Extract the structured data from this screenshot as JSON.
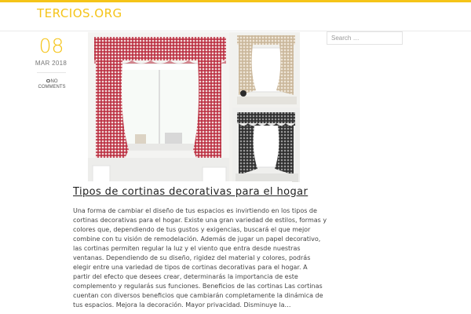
{
  "site": {
    "title": "TERCIOS.ORG",
    "accent_color": "#f5c418"
  },
  "search": {
    "placeholder": "Search …"
  },
  "post": {
    "day": "08",
    "month_year": "MAR 2018",
    "comments_line1": "NO",
    "comments_line2": "COMMENTS",
    "comments_icon": "comment-bubble-icon",
    "title": "Tipos de cortinas decorativas para el hogar",
    "excerpt_lines": [
      "Una forma de cambiar el diseño de tus espacios es invirtiendo en los tipos de",
      "cortinas decorativas para el hogar. Existe una gran variedad de estilos, formas y",
      "colores que, dependiendo de tus gustos y exigencias, buscará el que mejor",
      "combine con tu visión de remodelación. Además de jugar un papel decorativo,",
      "las cortinas permiten regular la luz y el viento que entra desde nuestras",
      "ventanas. Dependiendo de su diseño, rigidez del material y colores, podrás",
      "elegir entre una variedad de tipos de cortinas decorativas para el hogar. A",
      "partir del efecto que desees crear, determinarás la importancia de este",
      "complemento y regularás sus funciones. Beneficios de las cortinas Las cortinas",
      "cuentan con diversos beneficios que cambiarán completamente la dinámica de",
      "tus espacios.  Mejora la decoración. Mayor privacidad. Disminuye la…"
    ]
  }
}
